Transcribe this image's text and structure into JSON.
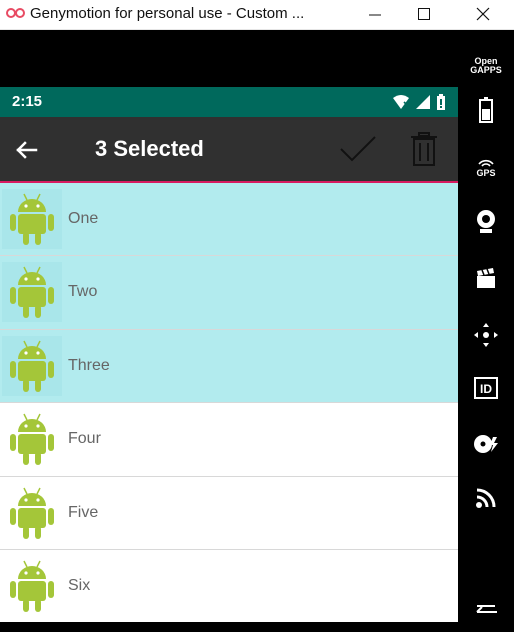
{
  "window": {
    "title": "Genymotion for personal use - Custom ..."
  },
  "status_bar": {
    "time": "2:15"
  },
  "action_bar": {
    "title": "3 Selected"
  },
  "sidebar": {
    "opengapps_line1": "Open",
    "opengapps_line2": "GAPPS",
    "gps_label": "GPS",
    "id_label": "ID"
  },
  "list": {
    "items": [
      {
        "label": "One",
        "selected": true
      },
      {
        "label": "Two",
        "selected": true
      },
      {
        "label": "Three",
        "selected": true
      },
      {
        "label": "Four",
        "selected": false
      },
      {
        "label": "Five",
        "selected": false
      },
      {
        "label": "Six",
        "selected": false
      }
    ]
  },
  "colors": {
    "status_bar": "#00695c",
    "action_bar": "#303030",
    "accent_line": "#d81b60",
    "selected_row": "#b2ebee",
    "android_green": "#a4c639"
  }
}
